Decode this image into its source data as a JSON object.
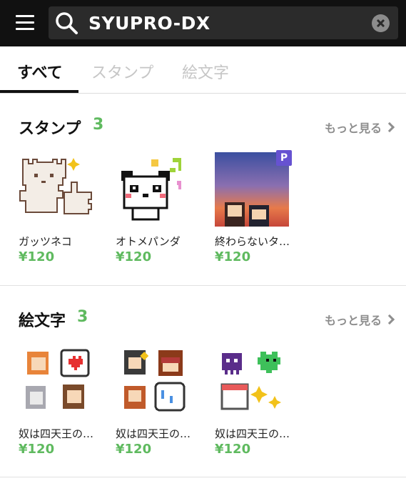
{
  "search": {
    "query": "SYUPRO-DX"
  },
  "tabs": [
    {
      "label": "すべて",
      "active": true
    },
    {
      "label": "スタンプ",
      "active": false
    },
    {
      "label": "絵文字",
      "active": false
    }
  ],
  "sections": {
    "stamps": {
      "title": "スタンプ",
      "count": "3",
      "more_label": "もっと見る",
      "items": [
        {
          "name": "ガッツネコ",
          "price": "¥120",
          "icon": "pixel-cat-thumbs-up-icon"
        },
        {
          "name": "オトメパンダ",
          "price": "¥120",
          "icon": "pixel-panda-music-icon"
        },
        {
          "name": "終わらないタ…",
          "price": "¥120",
          "icon": "pixel-sunset-couple-icon",
          "badge": "P"
        }
      ]
    },
    "emoji": {
      "title": "絵文字",
      "count": "3",
      "more_label": "もっと見る",
      "items": [
        {
          "name": "奴は四天王の…",
          "price": "¥120",
          "icon": "pixel-emoji-set-1-icon"
        },
        {
          "name": "奴は四天王の…",
          "price": "¥120",
          "icon": "pixel-emoji-set-2-icon"
        },
        {
          "name": "奴は四天王の…",
          "price": "¥120",
          "icon": "pixel-emoji-set-3-icon"
        }
      ]
    }
  },
  "colors": {
    "accent_green": "#5fba5f",
    "premium_badge": "#6652d1",
    "header_bg": "#111111"
  }
}
